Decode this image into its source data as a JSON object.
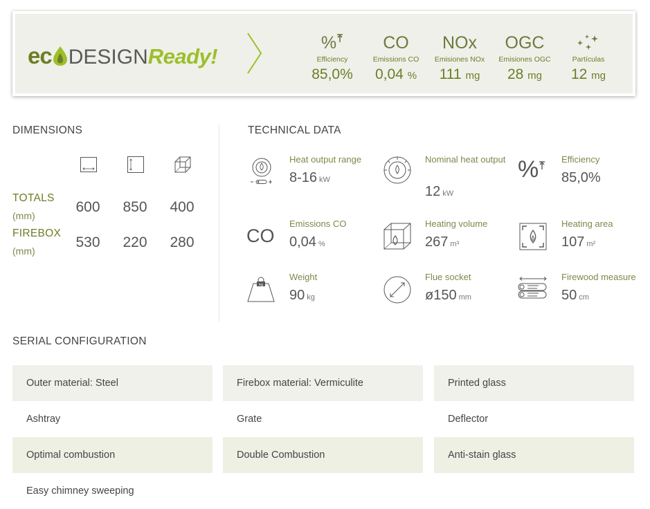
{
  "eco_banner": {
    "logo": {
      "eco_a": "ec",
      "eco_b": "o",
      "design": "DESIGN",
      "ready": "Ready!"
    },
    "metrics": [
      {
        "symbol": "%",
        "caption": "Efficiency",
        "value": "85,0%",
        "unit": ""
      },
      {
        "symbol": "CO",
        "caption": "Emissions CO",
        "value": "0,04",
        "unit": "%"
      },
      {
        "symbol": "NOx",
        "caption": "Emisiones NOx",
        "value": "111",
        "unit": "mg"
      },
      {
        "symbol": "OGC",
        "caption": "Emisiones OGC",
        "value": "28",
        "unit": "mg"
      },
      {
        "symbol": "",
        "caption": "Partículas",
        "value": "12",
        "unit": "mg"
      }
    ]
  },
  "dimensions": {
    "title": "DIMENSIONS",
    "icons": [
      "width-icon",
      "height-icon",
      "depth-icon"
    ],
    "rows": [
      {
        "label": "TOTALS",
        "unit": "(mm)",
        "values": [
          "600",
          "850",
          "400"
        ]
      },
      {
        "label": "FIREBOX",
        "unit": "(mm)",
        "values": [
          "530",
          "220",
          "280"
        ]
      }
    ]
  },
  "technical_data": {
    "title": "TECHNICAL DATA",
    "items": [
      {
        "icon": "heat-output-range-icon",
        "label": "Heat output range",
        "value": "8-16",
        "unit": "kW"
      },
      {
        "icon": "nominal-heat-output-icon",
        "label": "Nominal heat output",
        "value": "12",
        "unit": "kW"
      },
      {
        "icon": "efficiency-icon",
        "label": "Efficiency",
        "value": "85,0%",
        "unit": ""
      },
      {
        "icon": "emissions-co-icon",
        "label": "Emissions CO",
        "value": "0,04",
        "unit": "%"
      },
      {
        "icon": "heating-volume-icon",
        "label": "Heating volume",
        "value": "267",
        "unit": "m³"
      },
      {
        "icon": "heating-area-icon",
        "label": "Heating area",
        "value": "107",
        "unit": "m²"
      },
      {
        "icon": "weight-icon",
        "label": "Weight",
        "value": "90",
        "unit": "kg"
      },
      {
        "icon": "flue-socket-icon",
        "label": "Flue socket",
        "value": "ø150",
        "unit": "mm"
      },
      {
        "icon": "firewood-measure-icon",
        "label": "Firewood measure",
        "value": "50",
        "unit": "cm"
      }
    ],
    "co_symbol": "CO",
    "pct_symbol": "%",
    "weight_tag": "kg"
  },
  "serial_configuration": {
    "title": "SERIAL CONFIGURATION",
    "items": [
      "Outer material: Steel",
      "Firebox material: Vermiculite",
      "Printed glass",
      "Ashtray",
      "Grate",
      "Deflector",
      "Optimal combustion",
      "Double Combustion",
      "Anti-stain glass",
      "Easy chimney sweeping"
    ]
  },
  "colors": {
    "accent_green": "#6b7f25",
    "lime_green": "#9cbf2a",
    "banner_bg": "#eff0ea",
    "text_gray": "#555555"
  }
}
